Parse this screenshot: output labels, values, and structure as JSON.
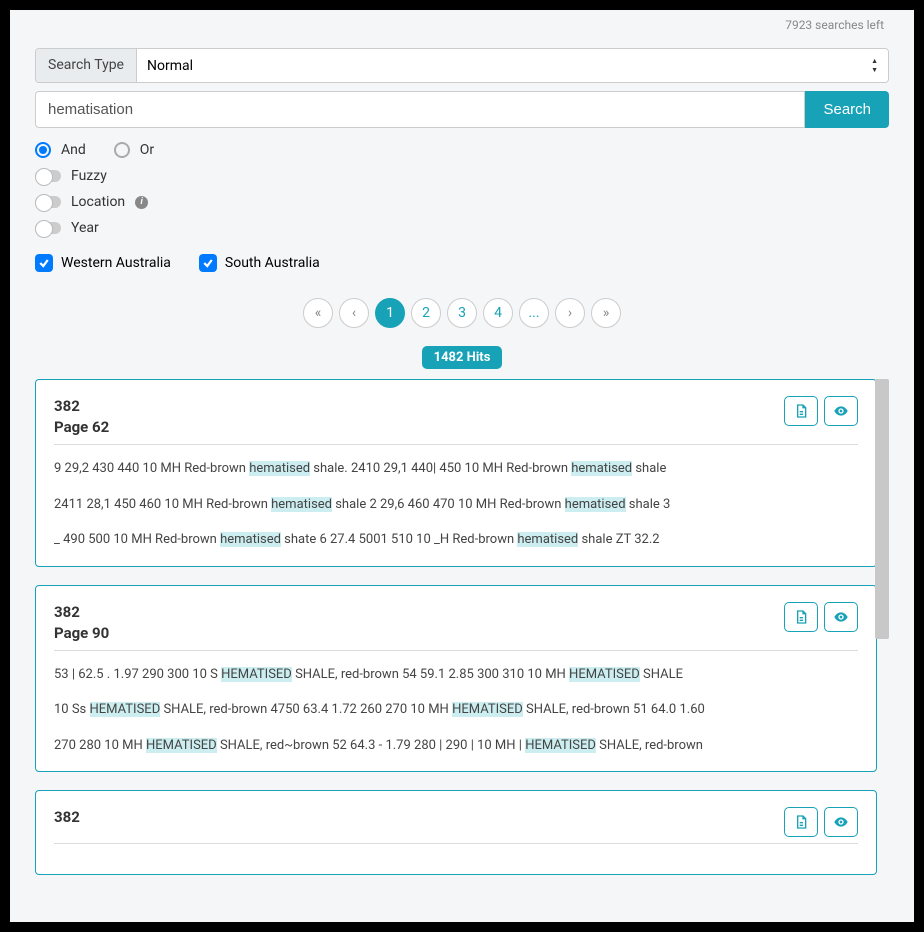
{
  "searches_left": "7923 searches left",
  "search_type_label": "Search Type",
  "search_type_value": "Normal",
  "search_value": "hematisation",
  "search_button": "Search",
  "logic": {
    "and": "And",
    "or": "Or",
    "selected": "and"
  },
  "toggles": {
    "fuzzy": "Fuzzy",
    "location": "Location",
    "year": "Year"
  },
  "states": [
    {
      "label": "Western Australia",
      "checked": true
    },
    {
      "label": "South Australia",
      "checked": true
    }
  ],
  "pagination": {
    "first": "«",
    "prev": "‹",
    "next": "›",
    "last": "»",
    "pages": [
      "1",
      "2",
      "3",
      "4",
      "..."
    ],
    "active": "1"
  },
  "hits_label": "1482 Hits",
  "results": [
    {
      "id": "382",
      "page": "Page 62",
      "snippets": [
        [
          {
            "t": "9 29,2 430 440 10 MH Red-brown "
          },
          {
            "t": "hematised",
            "hl": true
          },
          {
            "t": " shale. 2410 29,1 440| 450 10 MH Red-brown "
          },
          {
            "t": "hematised",
            "hl": true
          },
          {
            "t": " shale"
          }
        ],
        [
          {
            "t": "2411 28,1 450 460 10 MH Red-brown "
          },
          {
            "t": "hematised",
            "hl": true
          },
          {
            "t": " shale 2 29,6 460 470 10 MH Red-brown "
          },
          {
            "t": "hematised",
            "hl": true
          },
          {
            "t": " shale 3"
          }
        ],
        [
          {
            "t": "_ 490 500 10 MH Red-brown "
          },
          {
            "t": "hematised",
            "hl": true
          },
          {
            "t": " shate 6 27.4 5001 510 10 _H Red-brown "
          },
          {
            "t": "hematised",
            "hl": true
          },
          {
            "t": " shale ZT 32.2"
          }
        ]
      ]
    },
    {
      "id": "382",
      "page": "Page 90",
      "snippets": [
        [
          {
            "t": "53 | 62.5 . 1.97 290 300 10 S "
          },
          {
            "t": "HEMATISED",
            "hl": true
          },
          {
            "t": " SHALE, red-brown 54 59.1 2.85 300 310 10 MH "
          },
          {
            "t": "HEMATISED",
            "hl": true
          },
          {
            "t": " SHALE"
          }
        ],
        [
          {
            "t": "10 Ss "
          },
          {
            "t": "HEMATISED",
            "hl": true
          },
          {
            "t": " SHALE, red-brown 4750 63.4 1.72 260 270 10 MH "
          },
          {
            "t": "HEMATISED",
            "hl": true
          },
          {
            "t": " SHALE, red-brown 51 64.0 1.60"
          }
        ],
        [
          {
            "t": "270 280 10 MH "
          },
          {
            "t": "HEMATISED",
            "hl": true
          },
          {
            "t": " SHALE, red~brown 52 64.3 - 1.79 280 | 290 | 10 MH | "
          },
          {
            "t": "HEMATISED",
            "hl": true
          },
          {
            "t": " SHALE, red-brown"
          }
        ]
      ]
    },
    {
      "id": "382",
      "page": "",
      "snippets": []
    }
  ]
}
